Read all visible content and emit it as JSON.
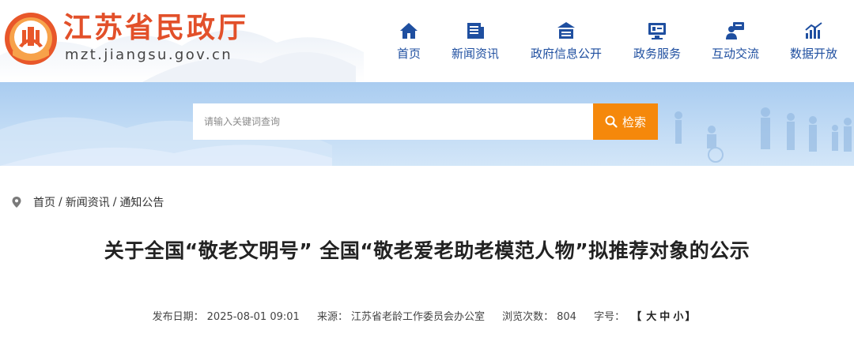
{
  "site": {
    "name": "江苏省民政厅",
    "domain": "mzt.jiangsu.gov.cn"
  },
  "nav": {
    "items": [
      {
        "label": "首页",
        "icon": "home-icon"
      },
      {
        "label": "新闻资讯",
        "icon": "news-icon"
      },
      {
        "label": "政府信息公开",
        "icon": "gov-info-icon"
      },
      {
        "label": "政务服务",
        "icon": "service-icon"
      },
      {
        "label": "互动交流",
        "icon": "interaction-icon"
      },
      {
        "label": "数据开放",
        "icon": "data-icon"
      }
    ]
  },
  "search": {
    "placeholder": "请输入关键词查询",
    "button_label": "检索"
  },
  "breadcrumb": {
    "items": [
      "首页",
      "新闻资讯",
      "通知公告"
    ],
    "separator": "/"
  },
  "article": {
    "title": "关于全国“敬老文明号” 全国“敬老爱老助老模范人物”拟推荐对象的公示",
    "meta": {
      "date_label": "发布日期：",
      "date_value": "2025-08-01 09:01",
      "source_label": "来源：",
      "source_value": "江苏省老龄工作委员会办公室",
      "views_label": "浏览次数：",
      "views_value": "804",
      "font_label": "字号：",
      "bracket_open": "【",
      "size_large": "大",
      "size_medium": "中",
      "size_small": "小",
      "bracket_close": "】"
    }
  },
  "colors": {
    "brand": "#e2502a",
    "nav": "#1f4fa0",
    "accent": "#f5880b",
    "banner": "#b9d6f3"
  }
}
